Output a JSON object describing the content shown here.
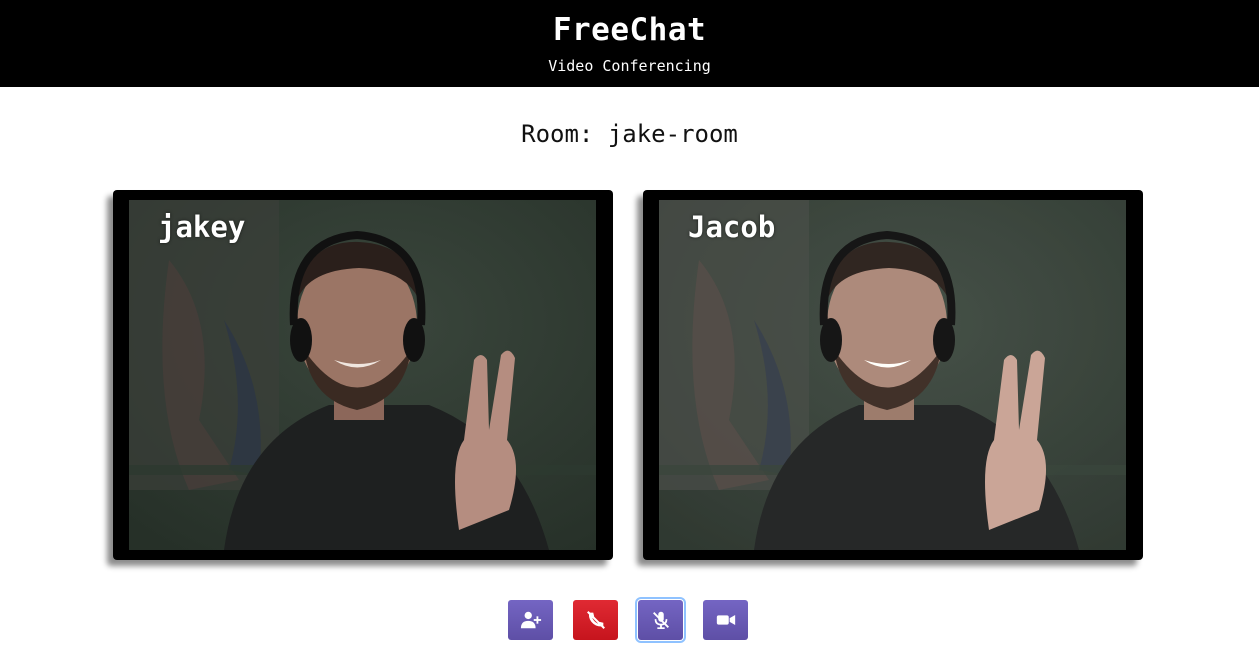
{
  "header": {
    "title": "FreeChat",
    "subtitle": "Video Conferencing"
  },
  "room": {
    "label": "Room: jake-room"
  },
  "participants": [
    {
      "name": "jakey"
    },
    {
      "name": "Jacob"
    }
  ],
  "controls": {
    "add_user": {
      "icon": "add-user-icon",
      "color": "#6a5bb5"
    },
    "hang_up": {
      "icon": "phone-hangup-icon",
      "color": "#d51f28"
    },
    "mute": {
      "icon": "microphone-muted-icon",
      "color": "#6a5bb5",
      "focused": true
    },
    "video": {
      "icon": "video-camera-icon",
      "color": "#6a5bb5"
    }
  },
  "colors": {
    "header_bg": "#000000",
    "accent_purple": "#6a5bb5",
    "hangup_red": "#d51f28"
  }
}
